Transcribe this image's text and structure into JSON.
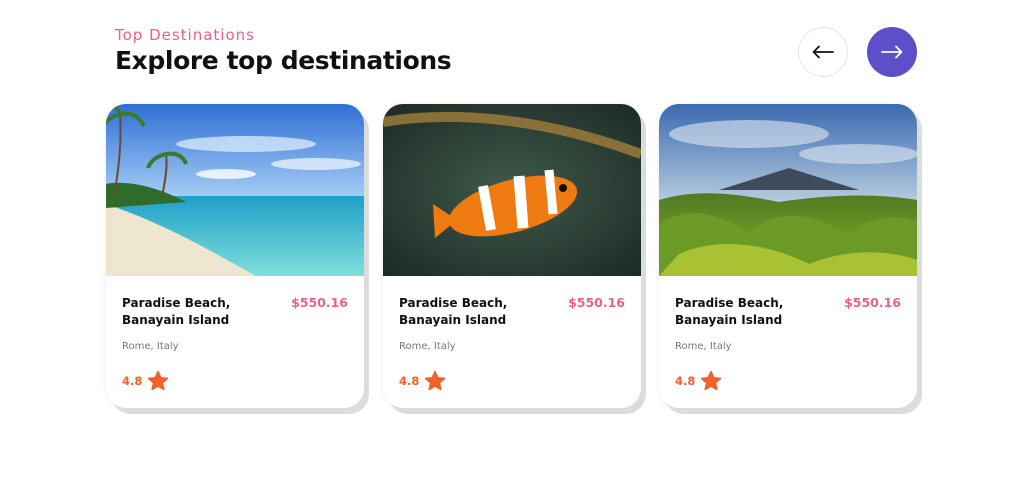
{
  "header": {
    "eyebrow": "Top Destinations",
    "title": "Explore top destinations"
  },
  "nav": {
    "prev_icon": "arrow-left-icon",
    "next_icon": "arrow-right-icon"
  },
  "colors": {
    "accent": "#5d4fc9",
    "pink": "#ee5f8a",
    "orange": "#f0612b"
  },
  "cards": [
    {
      "name": "Paradise Beach, Banayain Island",
      "price": "$550.16",
      "location": "Rome, Italy",
      "rating": "4.8",
      "image": "beach-photo"
    },
    {
      "name": "Paradise Beach, Banayain Island",
      "price": "$550.16",
      "location": "Rome, Italy",
      "rating": "4.8",
      "image": "clownfish-photo"
    },
    {
      "name": "Paradise Beach, Banayain Island",
      "price": "$550.16",
      "location": "Rome, Italy",
      "rating": "4.8",
      "image": "mountain-photo"
    }
  ]
}
